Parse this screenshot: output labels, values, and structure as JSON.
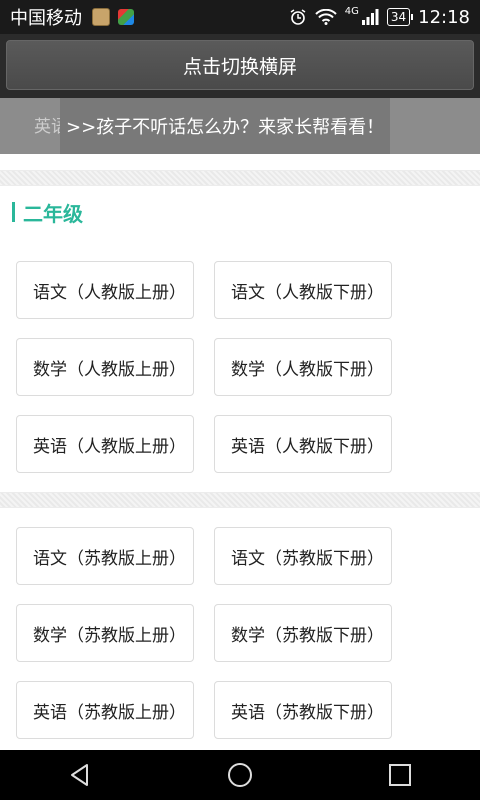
{
  "status_bar": {
    "carrier": "中国移动",
    "network": "4G",
    "battery": "34",
    "time": "12:18"
  },
  "toolbar": {
    "toggle_label": "点击切换横屏"
  },
  "banner": {
    "behind_text": "英语",
    "text": ">>孩子不听话怎么办？来家长帮看看！"
  },
  "section": {
    "title": "二年级"
  },
  "books": [
    "语文（人教版上册）",
    "语文（人教版下册）",
    "数学（人教版上册）",
    "数学（人教版下册）",
    "英语（人教版上册）",
    "英语（人教版下册）",
    "语文（苏教版上册）",
    "语文（苏教版下册）",
    "数学（苏教版上册）",
    "数学（苏教版下册）",
    "英语（苏教版上册）",
    "英语（苏教版下册）"
  ],
  "colors": {
    "accent": "#2ab79a",
    "toolbar": "#2b2b2b",
    "banner": "#8c8c8c"
  },
  "icons": {
    "nav": [
      "back-icon",
      "home-icon",
      "recents-icon"
    ]
  }
}
